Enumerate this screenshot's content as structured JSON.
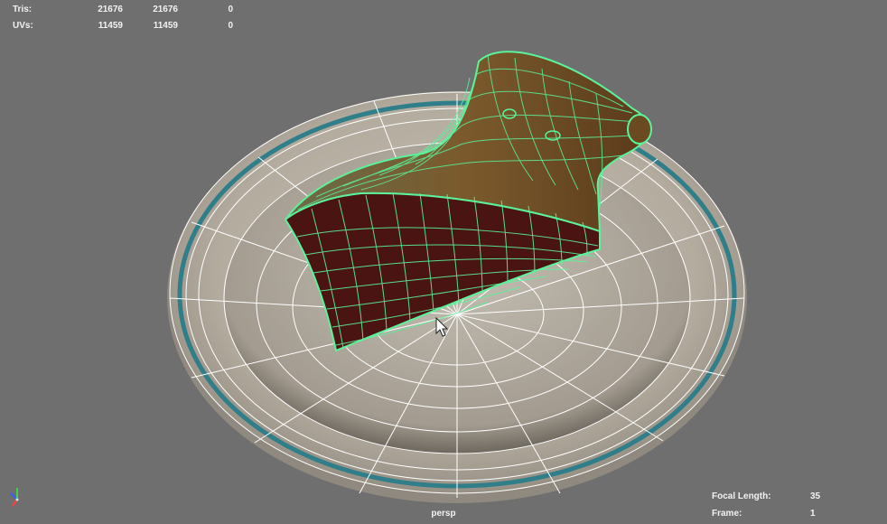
{
  "hud": {
    "tris": {
      "label": "Tris:",
      "values": [
        "21676",
        "21676",
        "0"
      ]
    },
    "uvs": {
      "label": "UVs:",
      "values": [
        "11459",
        "11459",
        "0"
      ]
    }
  },
  "camera": {
    "name": "persp",
    "focal_length_label": "Focal Length:",
    "focal_length_value": "35",
    "frame_label": "Frame:",
    "frame_value": "1"
  },
  "colors": {
    "viewport_bg": "#6f6f6f",
    "plate": "#b9b2a6",
    "plate_rim_band": "#2f7e8a",
    "wireframe_selected": "#5cf29a",
    "wireframe_unselected": "#ffffff",
    "cake_interior": "#4a1412",
    "cake_top": "#6b4a22"
  },
  "icons": {
    "cursor": "mouse-pointer-icon",
    "axis": "axis-gizmo-icon"
  }
}
